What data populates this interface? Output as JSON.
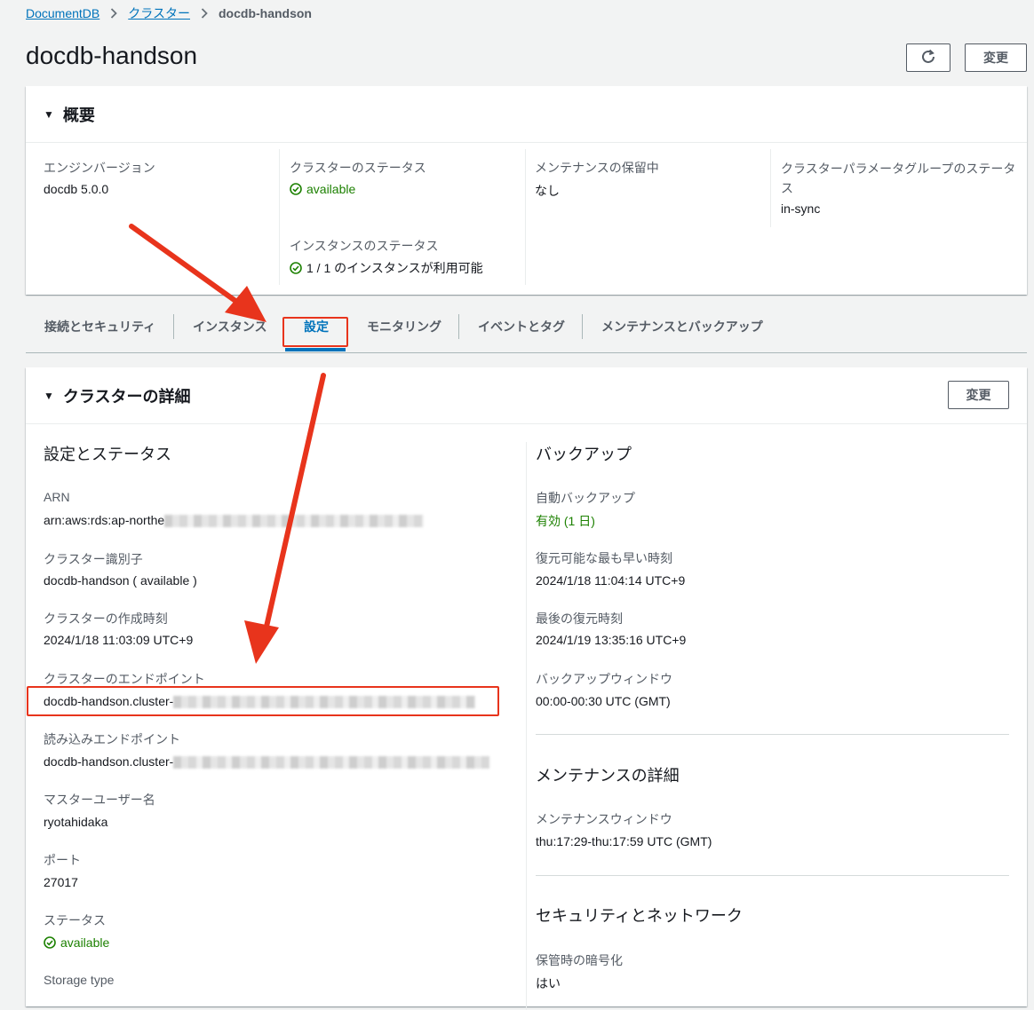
{
  "breadcrumb": {
    "root": "DocumentDB",
    "parent": "クラスター",
    "current": "docdb-handson"
  },
  "page_title": "docdb-handson",
  "header_buttons": {
    "modify": "変更"
  },
  "overview": {
    "title": "概要",
    "engine_version_label": "エンジンバージョン",
    "engine_version_value": "docdb 5.0.0",
    "cluster_status_label": "クラスターのステータス",
    "cluster_status_value": "available",
    "instance_status_label": "インスタンスのステータス",
    "instance_status_value": "1 / 1 のインスタンスが利用可能",
    "maintenance_label": "メンテナンスの保留中",
    "maintenance_value": "なし",
    "param_group_label": "クラスターパラメータグループのステータス",
    "param_group_value": "in-sync"
  },
  "tabs": [
    {
      "label": "接続とセキュリティ"
    },
    {
      "label": "インスタンス"
    },
    {
      "label": "設定"
    },
    {
      "label": "モニタリング"
    },
    {
      "label": "イベントとタグ"
    },
    {
      "label": "メンテナンスとバックアップ"
    }
  ],
  "active_tab": "設定",
  "details": {
    "title": "クラスターの詳細",
    "modify_label": "変更",
    "left": {
      "section_title": "設定とステータス",
      "arn_label": "ARN",
      "arn_value": "arn:aws:rds:ap-northe",
      "identifier_label": "クラスター識別子",
      "identifier_value": "docdb-handson ( available )",
      "created_label": "クラスターの作成時刻",
      "created_value": "2024/1/18 11:03:09 UTC+9",
      "endpoint_label": "クラスターのエンドポイント",
      "endpoint_value": "docdb-handson.cluster-",
      "reader_label": "読み込みエンドポイント",
      "reader_value": "docdb-handson.cluster-",
      "master_user_label": "マスターユーザー名",
      "master_user_value": "ryotahidaka",
      "port_label": "ポート",
      "port_value": "27017",
      "status_label": "ステータス",
      "status_value": "available",
      "storage_label": "Storage type"
    },
    "right": {
      "backup_title": "バックアップ",
      "auto_backup_label": "自動バックアップ",
      "auto_backup_value": "有効 (1 日)",
      "earliest_label": "復元可能な最も早い時刻",
      "earliest_value": "2024/1/18 11:04:14 UTC+9",
      "latest_label": "最後の復元時刻",
      "latest_value": "2024/1/19 13:35:16 UTC+9",
      "window_label": "バックアップウィンドウ",
      "window_value": "00:00-00:30 UTC (GMT)",
      "maint_title": "メンテナンスの詳細",
      "maint_window_label": "メンテナンスウィンドウ",
      "maint_window_value": "thu:17:29-thu:17:59 UTC (GMT)",
      "security_title": "セキュリティとネットワーク",
      "encryption_label": "保管時の暗号化",
      "encryption_value": "はい"
    }
  },
  "colors": {
    "link": "#0073bb",
    "success": "#1d8102",
    "annotation": "#e8341c"
  }
}
